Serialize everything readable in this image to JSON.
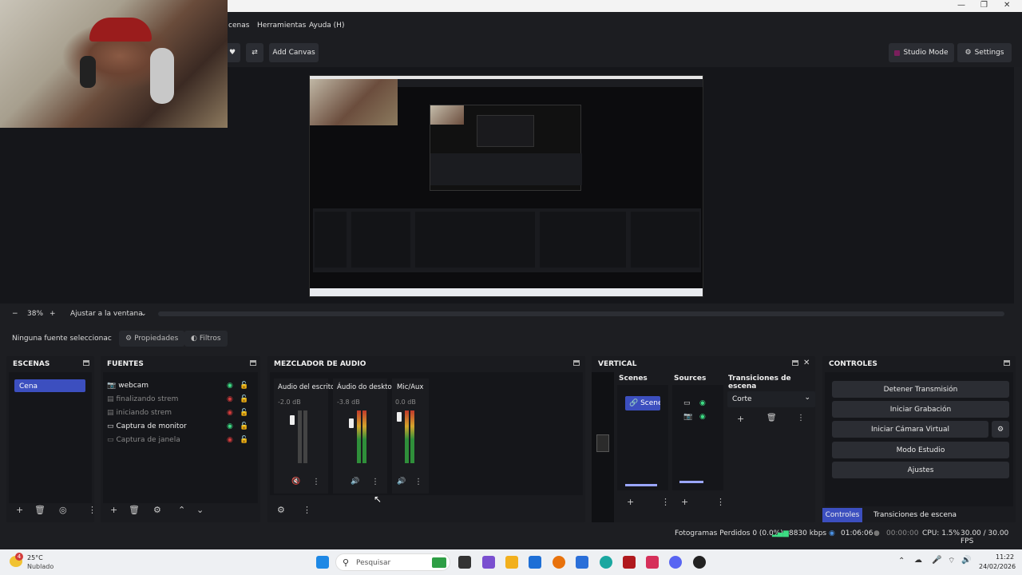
{
  "menu": {
    "scenes_label": "cenas",
    "tools_label": "Herramientas",
    "help_label": "Ayuda (H)"
  },
  "toolbar": {
    "add_canvas": "Add Canvas",
    "studio_mode": "Studio Mode",
    "settings": "Settings"
  },
  "zoom": {
    "minus": "−",
    "value": "38%",
    "plus": "+",
    "fit": "Ajustar a la ventana"
  },
  "source_bar": {
    "no_source": "Ninguna fuente seleccionac",
    "properties": "Propiedades",
    "filters": "Filtros"
  },
  "scenes_dock": {
    "title": "ESCENAS",
    "items": [
      "Cena"
    ]
  },
  "sources_dock": {
    "title": "FUENTES",
    "items": [
      {
        "label": "webcam",
        "icon": "camera-icon",
        "visible": true
      },
      {
        "label": "finalizando strem",
        "icon": "image-icon",
        "visible": false
      },
      {
        "label": "iniciando strem",
        "icon": "image-icon",
        "visible": false
      },
      {
        "label": "Captura de monitor",
        "icon": "monitor-icon",
        "visible": true
      },
      {
        "label": "Captura de janela",
        "icon": "window-icon",
        "visible": false
      }
    ]
  },
  "mixer_dock": {
    "title": "MEZCLADOR DE AUDIO",
    "channels": [
      {
        "name": "Audio del escritc",
        "db": "-2.0 dB",
        "muted": true
      },
      {
        "name": "Áudio do deskto",
        "db": "-3.8 dB",
        "muted": false
      },
      {
        "name": "Mic/Aux",
        "db": "0.0 dB",
        "muted": false
      }
    ],
    "scale": [
      "0",
      "-5",
      "-10",
      "-15",
      "-20",
      "-25",
      "-30",
      "-35",
      "-40",
      "-45",
      "-50",
      "-55",
      "-60"
    ]
  },
  "vertical_dock": {
    "title": "VERTICAL",
    "scenes_header": "Scenes",
    "sources_header": "Sources",
    "transitions_header": "Transiciones de escena",
    "scene_item": "Scene",
    "transition_value": "Corte"
  },
  "controls_dock": {
    "title": "CONTROLES",
    "buttons": [
      "Detener Transmisión",
      "Iniciar Grabación",
      "Iniciar Cámara Virtual",
      "Modo Estudio",
      "Ajustes"
    ],
    "tabs": [
      "Controles",
      "Transiciones de escena"
    ]
  },
  "status": {
    "dropped": "Fotogramas Perdidos 0 (0.0%)",
    "bitrate": "8830 kbps",
    "stream_time": "01:06:06",
    "rec_time": "00:00:00",
    "cpu": "CPU: 1.5%",
    "fps": "30.00 / 30.00 FPS"
  },
  "taskbar": {
    "weather_temp": "25°C",
    "weather_desc": "Nublado",
    "weather_badge": "4",
    "search_placeholder": "Pesquisar",
    "time": "11:22",
    "date": "24/02/2026"
  },
  "colors": {
    "accent": "#3c4fbf",
    "bg": "#1d1e22",
    "dock": "#15161a"
  }
}
